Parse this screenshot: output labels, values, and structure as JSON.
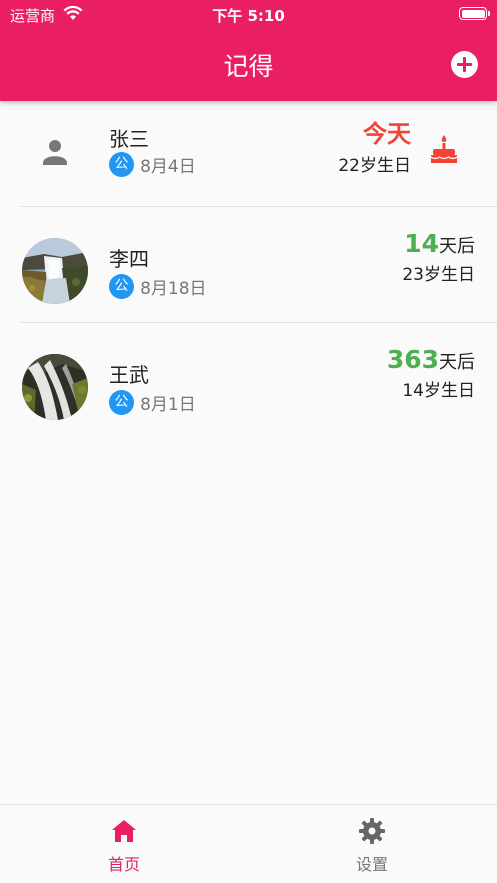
{
  "status_bar": {
    "carrier": "运营商",
    "time": "下午 5:10"
  },
  "header": {
    "title": "记得"
  },
  "contacts": [
    {
      "name": "张三",
      "calendar_badge": "公",
      "date": "8月4日",
      "countdown_text": "今天",
      "age_text": "22岁生日",
      "avatar": "person-icon",
      "today_icon": "cake-icon"
    },
    {
      "name": "李四",
      "calendar_badge": "公",
      "date": "8月18日",
      "days": "14",
      "days_suffix": "天后",
      "age_text": "23岁生日",
      "avatar": "waterfall-photo"
    },
    {
      "name": "王武",
      "calendar_badge": "公",
      "date": "8月1日",
      "days": "363",
      "days_suffix": "天后",
      "age_text": "14岁生日",
      "avatar": "waterfall-photo"
    }
  ],
  "bottom_nav": {
    "home_label": "首页",
    "settings_label": "设置"
  },
  "colors": {
    "primary": "#e91e63",
    "badge": "#2196f3",
    "today": "#f44336",
    "days": "#4caf50"
  }
}
